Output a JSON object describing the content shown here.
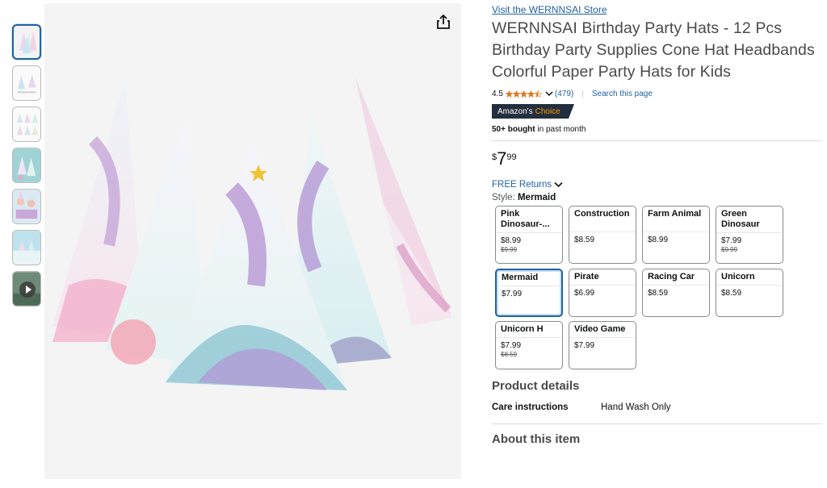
{
  "gallery": {
    "thumbnail_count": 7,
    "video_thumbnail_index": 6
  },
  "share_icon": "share-icon",
  "product": {
    "store_link": "Visit the WERNNSAI Store",
    "title": "WERNNSAI Birthday Party Hats - 12 Pcs Birthday Party Supplies Cone Hat Headbands Colorful Paper Party Hats for Kids",
    "rating": "4.5",
    "rating_stars": 4.5,
    "review_count": "(479)",
    "separator": "|",
    "search_page": "Search this page",
    "badge_prefix": "Amazon's",
    "badge_suffix": "Choice",
    "bought_bold": "50+ bought",
    "bought_rest": " in past month",
    "price": {
      "symbol": "$",
      "whole": "7",
      "fraction": "99"
    },
    "returns": "FREE Returns",
    "style_prefix": "Style: ",
    "style_value": "Mermaid"
  },
  "styles": [
    {
      "name": "Pink Dinosaur-...",
      "price": "$8.99",
      "old": "$9.99"
    },
    {
      "name": "Construction",
      "price": "$8.59",
      "old": ""
    },
    {
      "name": "Farm Animal",
      "price": "$8.99",
      "old": ""
    },
    {
      "name": "Green Dinosaur",
      "price": "$7.99",
      "old": "$9.99"
    },
    {
      "name": "Mermaid",
      "price": "$7.99",
      "old": "",
      "selected": true
    },
    {
      "name": "Pirate",
      "price": "$6.99",
      "old": ""
    },
    {
      "name": "Racing Car",
      "price": "$8.59",
      "old": ""
    },
    {
      "name": "Unicorn",
      "price": "$8.59",
      "old": ""
    },
    {
      "name": "Unicorn H",
      "price": "$7.99",
      "old": "$8.59"
    },
    {
      "name": "Video Game",
      "price": "$7.99",
      "old": ""
    }
  ],
  "details": {
    "title": "Product details",
    "care_key": "Care instructions",
    "care_value": "Hand Wash Only"
  },
  "about": {
    "title": "About this item"
  },
  "colors": {
    "link": "#2162a1",
    "star": "#de7921",
    "badge_bg": "#232f3e",
    "badge_accent": "#ff9900"
  }
}
